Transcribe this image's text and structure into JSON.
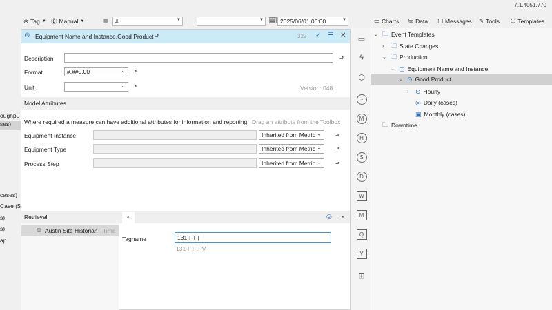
{
  "app": {
    "version": "7.1.4051.770"
  },
  "left_list": {
    "items": [
      "oughpu",
      "ses)",
      "cases)",
      "Case ($",
      "s)",
      "s)",
      "ap"
    ]
  },
  "toolbar": {
    "tag_label": "Tag",
    "manual_label": "Manual",
    "filter_value": "#",
    "second_value": "",
    "datetime_value": "2025/06/01 06:00"
  },
  "editor": {
    "title": "Equipment Name and Instance.Good Product",
    "count": "322",
    "description_label": "Description",
    "description_value": "",
    "format_label": "Format",
    "format_value": "#,##0.00",
    "unit_label": "Unit",
    "unit_value": "",
    "version_text": "Version: 048",
    "model_attributes_label": "Model Attributes",
    "attr_help_text": "Where required a measure can have additional attributes for information and reporting",
    "attr_hint_text": "Drag an attribute from the Toolbox",
    "attributes": [
      {
        "name": "Equipment Instance",
        "value": "",
        "mode": "Inherited from Metric"
      },
      {
        "name": "Equipment Type",
        "value": "",
        "mode": "Inherited from Metric"
      },
      {
        "name": "Process Step",
        "value": "",
        "mode": "Inherited from Metric"
      }
    ],
    "retrieval_label": "Retrieval",
    "retrieval_source": "Austin Site Historian",
    "retrieval_source_suffix": "Time",
    "tagname_label": "Tagname",
    "tagname_value": "131-FT-",
    "tagname_suggestion": "131-FT-.PV"
  },
  "toolbox": {
    "items": [
      "box-icon",
      "lightning-icon",
      "cube-icon",
      "trend-icon",
      "M",
      "H",
      "S",
      "D",
      "W",
      "M",
      "Q",
      "Y",
      "calculator-icon"
    ]
  },
  "right_tabs": [
    "Charts",
    "Data",
    "Messages",
    "Tools",
    "Templates"
  ],
  "tree": {
    "nodes": [
      {
        "label": "Event Templates",
        "level": 0,
        "expanded": true
      },
      {
        "label": "State Changes",
        "level": 1,
        "expanded": false
      },
      {
        "label": "Production",
        "level": 1,
        "expanded": true
      },
      {
        "label": "Equipment Name and Instance",
        "level": 2,
        "expanded": true
      },
      {
        "label": "Good Product",
        "level": 3,
        "expanded": true,
        "selected": true
      },
      {
        "label": "Hourly",
        "level": 4,
        "expanded": false
      },
      {
        "label": "Daily (cases)",
        "level": 4
      },
      {
        "label": "Monthly (cases)",
        "level": 4
      },
      {
        "label": "Downtime",
        "level": 0
      }
    ]
  }
}
